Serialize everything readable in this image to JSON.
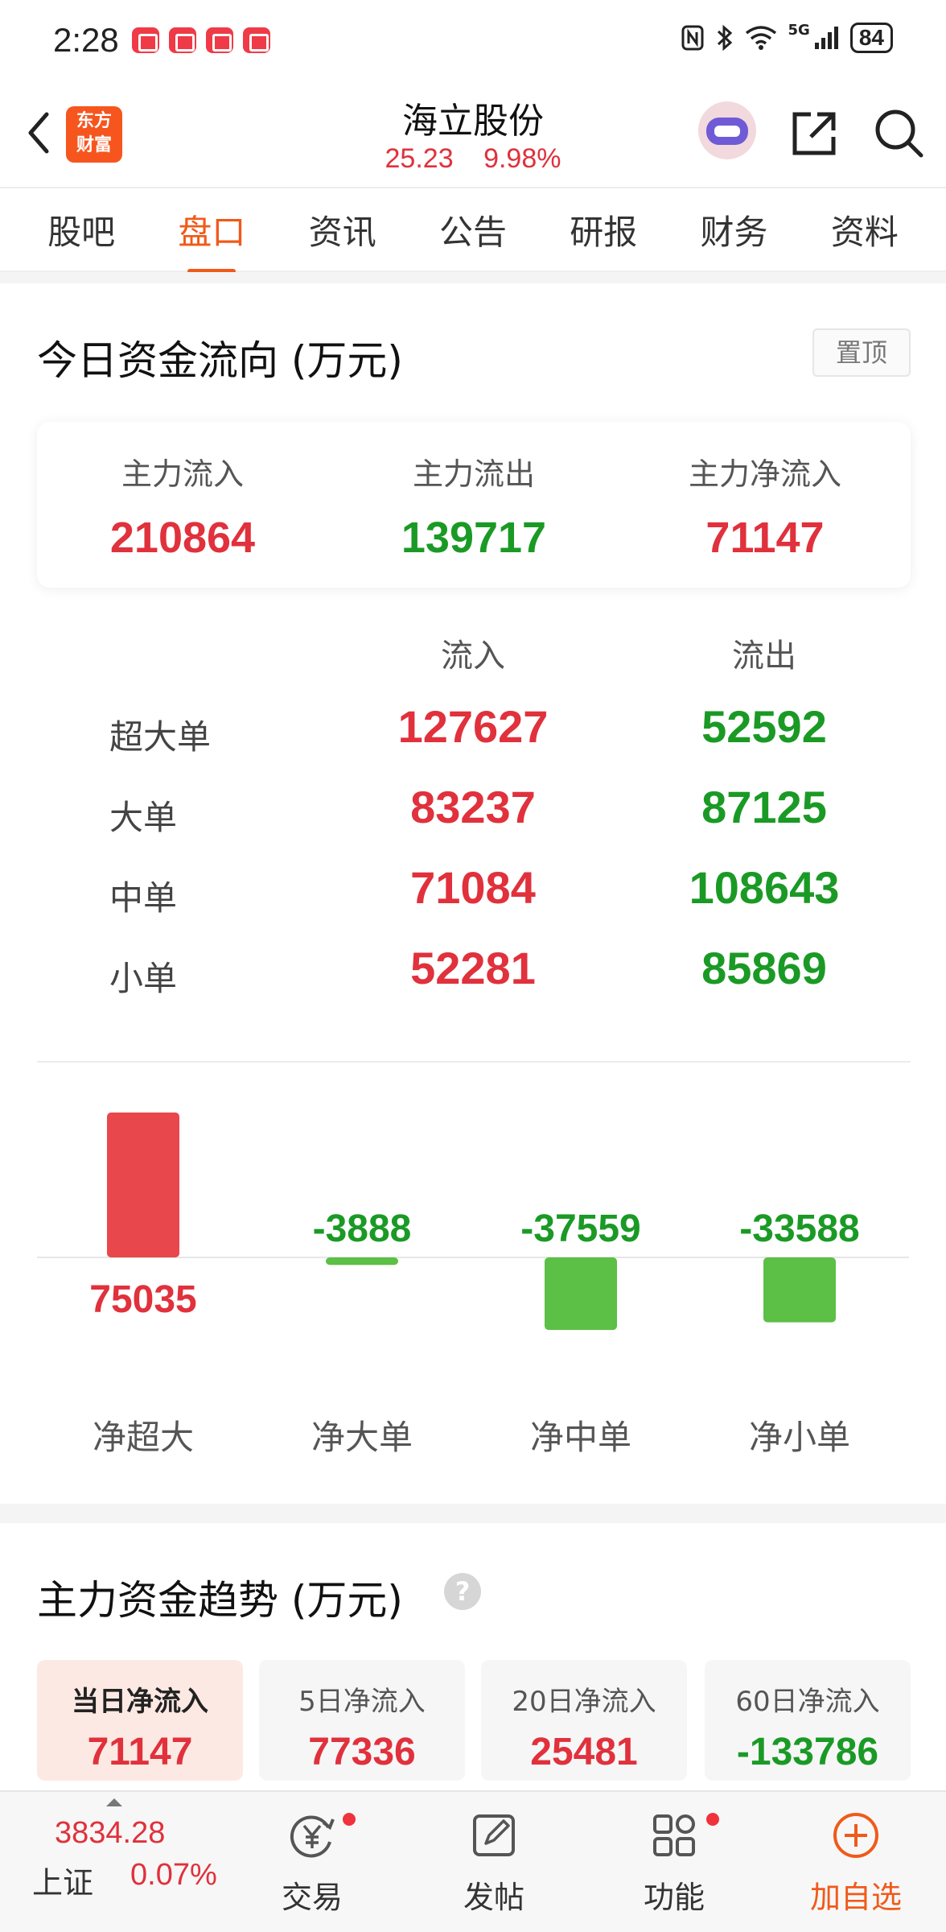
{
  "status_bar": {
    "time": "2:28",
    "network": "5G",
    "battery": "84"
  },
  "header": {
    "brand_logo_text": "东方财富",
    "stock_name": "海立股份",
    "price": "25.23",
    "change_pct": "9.98%"
  },
  "tabs": [
    {
      "label": "股吧",
      "active": false
    },
    {
      "label": "盘口",
      "active": true
    },
    {
      "label": "资讯",
      "active": false
    },
    {
      "label": "公告",
      "active": false
    },
    {
      "label": "研报",
      "active": false
    },
    {
      "label": "财务",
      "active": false
    },
    {
      "label": "资料",
      "active": false
    }
  ],
  "fund_flow": {
    "title": "今日资金流向 (万元)",
    "pin_label": "置顶",
    "summary": [
      {
        "label": "主力流入",
        "value": "210864"
      },
      {
        "label": "主力流出",
        "value": "139717"
      },
      {
        "label": "主力净流入",
        "value": "71147"
      }
    ],
    "col_in": "流入",
    "col_out": "流出",
    "rows": [
      {
        "label": "超大单",
        "in": "127627",
        "out": "52592"
      },
      {
        "label": "大单",
        "in": "83237",
        "out": "87125"
      },
      {
        "label": "中单",
        "in": "71084",
        "out": "108643"
      },
      {
        "label": "小单",
        "in": "52281",
        "out": "85869"
      }
    ]
  },
  "chart_data": {
    "type": "bar",
    "title": "",
    "categories": [
      "净超大",
      "净大单",
      "净中单",
      "净小单"
    ],
    "values": [
      75035,
      -3888,
      -37559,
      -33588
    ],
    "value_labels": [
      "75035",
      "-3888",
      "-37559",
      "-33588"
    ],
    "xlabel": "",
    "ylabel": "",
    "positive_color": "#e8474c",
    "negative_color": "#5cbf46",
    "grid": false
  },
  "trend": {
    "title": "主力资金趋势 (万元)",
    "help_icon": "question-icon",
    "cards": [
      {
        "label": "当日净流入",
        "value": "71147",
        "sign": "pos",
        "active": true
      },
      {
        "label": "5日净流入",
        "value": "77336",
        "sign": "pos",
        "active": false
      },
      {
        "label": "20日净流入",
        "value": "25481",
        "sign": "pos",
        "active": false
      },
      {
        "label": "60日净流入",
        "value": "-133786",
        "sign": "neg",
        "active": false
      }
    ]
  },
  "bottom_bar": {
    "index_value": "3834.28",
    "index_name": "上证",
    "index_change": "0.07%",
    "items": [
      {
        "label": "交易",
        "icon": "yuan-cycle-icon",
        "badge": true
      },
      {
        "label": "发帖",
        "icon": "edit-post-icon",
        "badge": false
      },
      {
        "label": "功能",
        "icon": "grid-apps-icon",
        "badge": true
      },
      {
        "label": "加自选",
        "icon": "add-circle-icon",
        "badge": false
      }
    ]
  },
  "colors": {
    "accent": "#f05a1a",
    "up": "#e0313c",
    "down": "#1a9a25"
  }
}
